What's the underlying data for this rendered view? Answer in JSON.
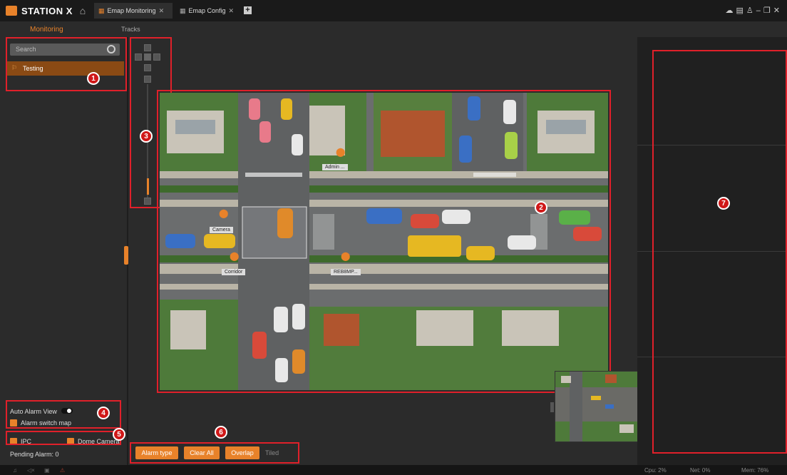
{
  "app": {
    "logo": "STATION X"
  },
  "tabs": [
    {
      "label": "Emap Monitoring",
      "close": "✕",
      "active": true
    },
    {
      "label": "Emap Config",
      "close": "✕",
      "active": false
    }
  ],
  "add_tab_label": "+",
  "subnav": {
    "monitoring": "Monitoring",
    "tracks": "Tracks"
  },
  "search": {
    "placeholder": "Search"
  },
  "tree": {
    "items": [
      {
        "label": "Testing"
      }
    ]
  },
  "map": {
    "pins": [
      {
        "label": "Admin ..."
      },
      {
        "label": "Camera"
      },
      {
        "label": "Corridor"
      },
      {
        "label": "REB8MP..."
      }
    ]
  },
  "left_bottom": {
    "auto_alarm_view": "Auto Alarm View",
    "alarm_switch_map": "Alarm switch map",
    "ipc": "IPC",
    "dome_camera": "Dome Camera",
    "pending_alarm": "Pending Alarm: 0"
  },
  "toolbar": {
    "alarm_type": "Alarm type",
    "clear_all": "Clear All",
    "overlap": "Overlap",
    "tiled": "Tiled"
  },
  "status": {
    "cpu": "Cpu: 2%",
    "net": "Net: 0%",
    "mem": "Mem: 76%"
  },
  "callouts": [
    "1",
    "2",
    "3",
    "4",
    "5",
    "6",
    "7"
  ],
  "colors": {
    "accent": "#e8822a",
    "highlight": "#e0202a",
    "background": "#2b2b2b"
  },
  "icons": [
    "home-icon",
    "map-icon",
    "search-icon",
    "flag-icon",
    "cloud-icon",
    "lock-icon",
    "minimize-icon",
    "restore-icon",
    "close-icon",
    "bell-icon",
    "speaker-icon"
  ]
}
